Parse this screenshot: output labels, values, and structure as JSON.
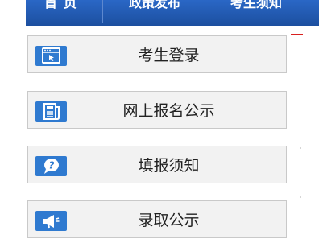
{
  "nav": {
    "items": [
      {
        "label": "首页"
      },
      {
        "label": "政策发布"
      },
      {
        "label": "考生须知"
      }
    ]
  },
  "menu": {
    "items": [
      {
        "label": "考生登录",
        "icon": "login-window-icon"
      },
      {
        "label": "网上报名公示",
        "icon": "newspaper-icon"
      },
      {
        "label": "填报须知",
        "icon": "question-bubble-icon"
      },
      {
        "label": "录取公示",
        "icon": "megaphone-icon"
      }
    ]
  },
  "colors": {
    "nav_bg": "#1f56ab",
    "icon_bg": "#2f7ad0",
    "item_bg": "#f2f2f2",
    "accent_red": "#d9201f"
  }
}
